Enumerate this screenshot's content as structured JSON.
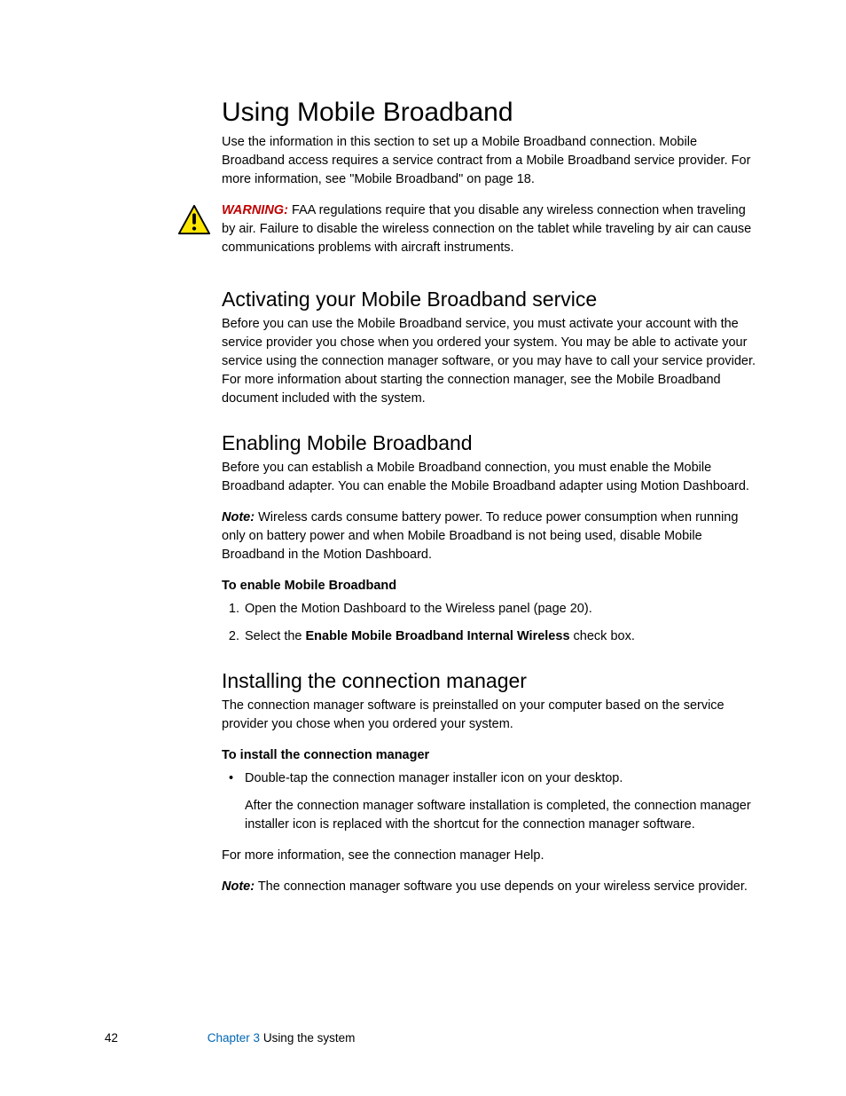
{
  "heading_main": "Using Mobile Broadband",
  "intro_p": "Use the information in this section to set up a Mobile Broadband connection. Mobile Broadband access requires a service contract from a Mobile Broadband service provider. For more information, see \"Mobile Broadband\" on page 18.",
  "warning_label": "WARNING:",
  "warning_text": " FAA regulations require that you disable any wireless connection when traveling by air. Failure to disable the wireless connection on the tablet while traveling by air can cause communications problems with aircraft instruments.",
  "sec1_heading": "Activating your Mobile Broadband service",
  "sec1_p": "Before you can use the Mobile Broadband service, you must activate your account with the service provider you chose when you ordered your system. You may be able to activate your service using the connection manager software, or you may have to call your service provider. For more information about starting the connection manager, see the Mobile Broadband document included with the system.",
  "sec2_heading": "Enabling Mobile Broadband",
  "sec2_p": "Before you can establish a Mobile Broadband connection, you must enable the Mobile Broadband adapter. You can enable the Mobile Broadband adapter using Motion Dashboard.",
  "note1_label": "Note:",
  "note1_text": " Wireless cards consume battery power. To reduce power consumption when running only on battery power and when Mobile Broadband is not being used, disable Mobile Broadband in the Motion Dashboard.",
  "proc1_heading": "To enable Mobile Broadband",
  "proc1_step1": "Open the Motion Dashboard to the Wireless panel (page 20).",
  "proc1_step2_a": "Select the ",
  "proc1_step2_b": "Enable Mobile Broadband Internal Wireless",
  "proc1_step2_c": " check box.",
  "sec3_heading": "Installing the connection manager",
  "sec3_p": "The connection manager software is preinstalled on your computer based on the service provider you chose when you ordered your system.",
  "proc2_heading": "To install the connection manager",
  "proc2_bullet": "Double-tap the connection manager installer icon on your desktop.",
  "proc2_bullet_sub": "After the connection manager software installation is completed, the connection manager installer icon is replaced with the shortcut for the connection manager software.",
  "sec3_more": "For more information, see the connection manager Help.",
  "note2_label": "Note:",
  "note2_text": " The connection manager software you use depends on your wireless service provider.",
  "footer_page": "42",
  "footer_chapter": "Chapter 3",
  "footer_title": "  Using the system"
}
